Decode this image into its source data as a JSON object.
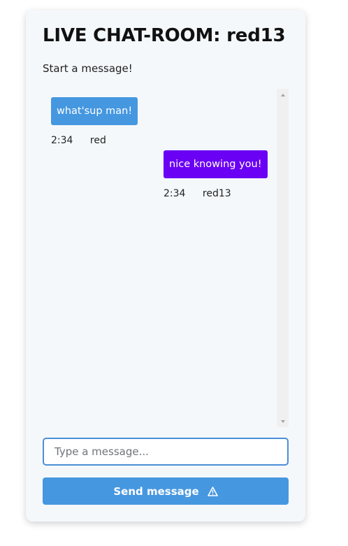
{
  "room": {
    "title": "LIVE CHAT-ROOM: red13",
    "subtitle": "Start a message!"
  },
  "messages": [
    {
      "text": "what'sup man!",
      "time": "2:34",
      "user": "red",
      "color": "#4597e0"
    },
    {
      "text": "nice knowing you!",
      "time": "2:34",
      "user": "red13",
      "color": "#6a00f4"
    }
  ],
  "composer": {
    "placeholder": "Type a message...",
    "value": "",
    "send_label": "Send message",
    "send_icon": "warning-triangle-icon"
  },
  "colors": {
    "card_bg": "#f5f8fb",
    "accent": "#4597e0",
    "own_message": "#6a00f4",
    "input_border": "#4a8fd8"
  }
}
